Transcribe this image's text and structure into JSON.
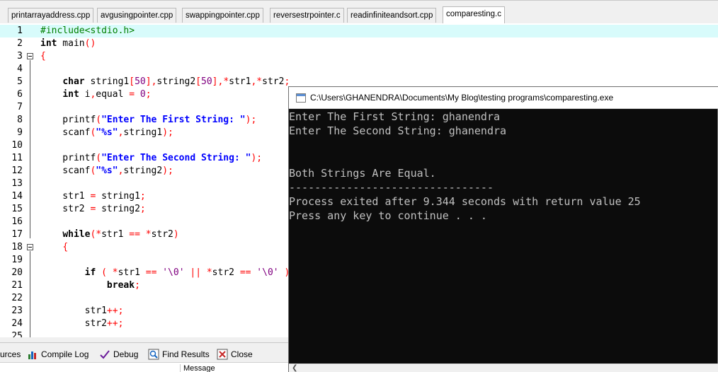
{
  "editor_tabs": [
    {
      "label": "printarrayaddress.cpp",
      "active": false
    },
    {
      "label": "avgusingpointer.cpp",
      "active": false
    },
    {
      "label": "swappingpointer.cpp",
      "active": false
    },
    {
      "label": "reversestrpointer.c",
      "active": false
    },
    {
      "label": "readinfiniteandsort.cpp",
      "active": false
    },
    {
      "label": "comparesting.c",
      "active": true
    }
  ],
  "code_lines": [
    {
      "n": "1",
      "text": "#include<stdio.h>"
    },
    {
      "n": "2",
      "text": "int main()"
    },
    {
      "n": "3",
      "text": "{"
    },
    {
      "n": "4",
      "text": ""
    },
    {
      "n": "5",
      "text": "    char string1[50],string2[50],*str1,*str2;"
    },
    {
      "n": "6",
      "text": "    int i,equal = 0;"
    },
    {
      "n": "7",
      "text": ""
    },
    {
      "n": "8",
      "text": "    printf(\"Enter The First String: \");"
    },
    {
      "n": "9",
      "text": "    scanf(\"%s\",string1);"
    },
    {
      "n": "10",
      "text": ""
    },
    {
      "n": "11",
      "text": "    printf(\"Enter The Second String: \");"
    },
    {
      "n": "12",
      "text": "    scanf(\"%s\",string2);"
    },
    {
      "n": "13",
      "text": ""
    },
    {
      "n": "14",
      "text": "    str1 = string1;"
    },
    {
      "n": "15",
      "text": "    str2 = string2;"
    },
    {
      "n": "16",
      "text": ""
    },
    {
      "n": "17",
      "text": "    while(*str1 == *str2)"
    },
    {
      "n": "18",
      "text": "    {"
    },
    {
      "n": "19",
      "text": ""
    },
    {
      "n": "20",
      "text": "        if ( *str1 == '\\0' || *str2 == '\\0' )"
    },
    {
      "n": "21",
      "text": "            break;"
    },
    {
      "n": "22",
      "text": ""
    },
    {
      "n": "23",
      "text": "        str1++;"
    },
    {
      "n": "24",
      "text": "        str2++;"
    },
    {
      "n": "25",
      "text": ""
    }
  ],
  "bottom_tabs": [
    {
      "label": "urces",
      "icon": "resources-icon"
    },
    {
      "label": "Compile Log",
      "icon": "compile-log-icon"
    },
    {
      "label": "Debug",
      "icon": "debug-check-icon"
    },
    {
      "label": "Find Results",
      "icon": "find-results-icon"
    },
    {
      "label": "Close",
      "icon": "close-icon"
    }
  ],
  "message_header": "Message",
  "console": {
    "title": "C:\\Users\\GHANENDRA\\Documents\\My Blog\\testing programs\\comparesting.exe",
    "lines": [
      "Enter The First String: ghanendra",
      "Enter The Second String: ghanendra",
      "",
      "",
      "Both Strings Are Equal.",
      "--------------------------------",
      "Process exited after 9.344 seconds with return value 25",
      "Press any key to continue . . ."
    ]
  },
  "colors": {
    "highlight_line": "#d8fbfb",
    "keyword": "#000000",
    "string": "#0000ff",
    "operator": "#ff0000",
    "number": "#800080",
    "preprocessor": "#008000",
    "console_bg": "#0c0c0c",
    "console_text": "#c0c0c0"
  }
}
